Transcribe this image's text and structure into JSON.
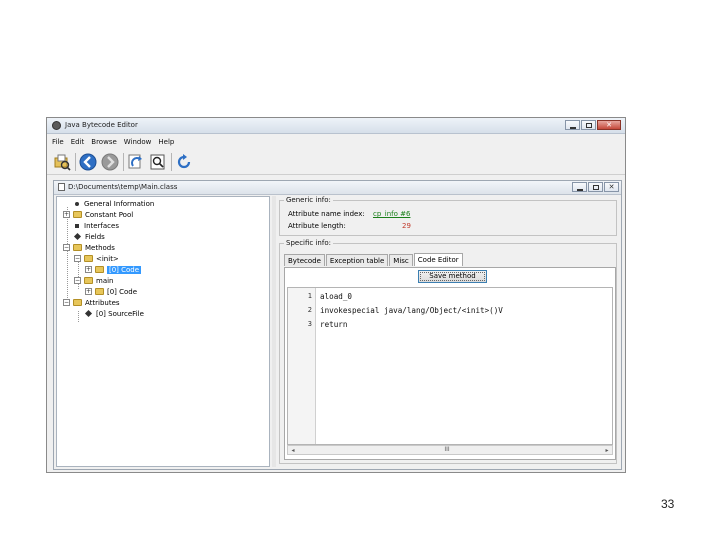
{
  "window": {
    "title": "Java Bytecode Editor"
  },
  "menubar": {
    "items": [
      "File",
      "Edit",
      "Browse",
      "Window",
      "Help"
    ]
  },
  "toolbar": {
    "icons": [
      "open-icon",
      "back-icon",
      "forward-icon",
      "reload-icon",
      "find-icon",
      "refresh-icon"
    ]
  },
  "document": {
    "path": "D:\\Documents\\temp\\Main.class"
  },
  "tree": {
    "general_information": "General Information",
    "constant_pool": "Constant Pool",
    "interfaces": "Interfaces",
    "fields": "Fields",
    "methods": "Methods",
    "init": "<init>",
    "init_code": "[0] Code",
    "main": "main",
    "main_code": "[0] Code",
    "attributes": "Attributes",
    "source_file": "[0] SourceFile"
  },
  "general_info": {
    "legend": "Generic info:",
    "attr_name_index_label": "Attribute name index:",
    "attr_name_index_value": "cp_info #6",
    "attr_length_label": "Attribute length:",
    "attr_length_value": "29"
  },
  "specific_info": {
    "legend": "Specific info:",
    "tabs": [
      "Bytecode",
      "Exception table",
      "Misc",
      "Code Editor"
    ],
    "save_button": "Save method",
    "code_lines": [
      {
        "n": "1",
        "text": "aload_0"
      },
      {
        "n": "2",
        "text": "invokespecial java/lang/Object/<init>()V"
      },
      {
        "n": "3",
        "text": "return"
      }
    ],
    "scroll_thumb": "III"
  },
  "page_number": "33"
}
